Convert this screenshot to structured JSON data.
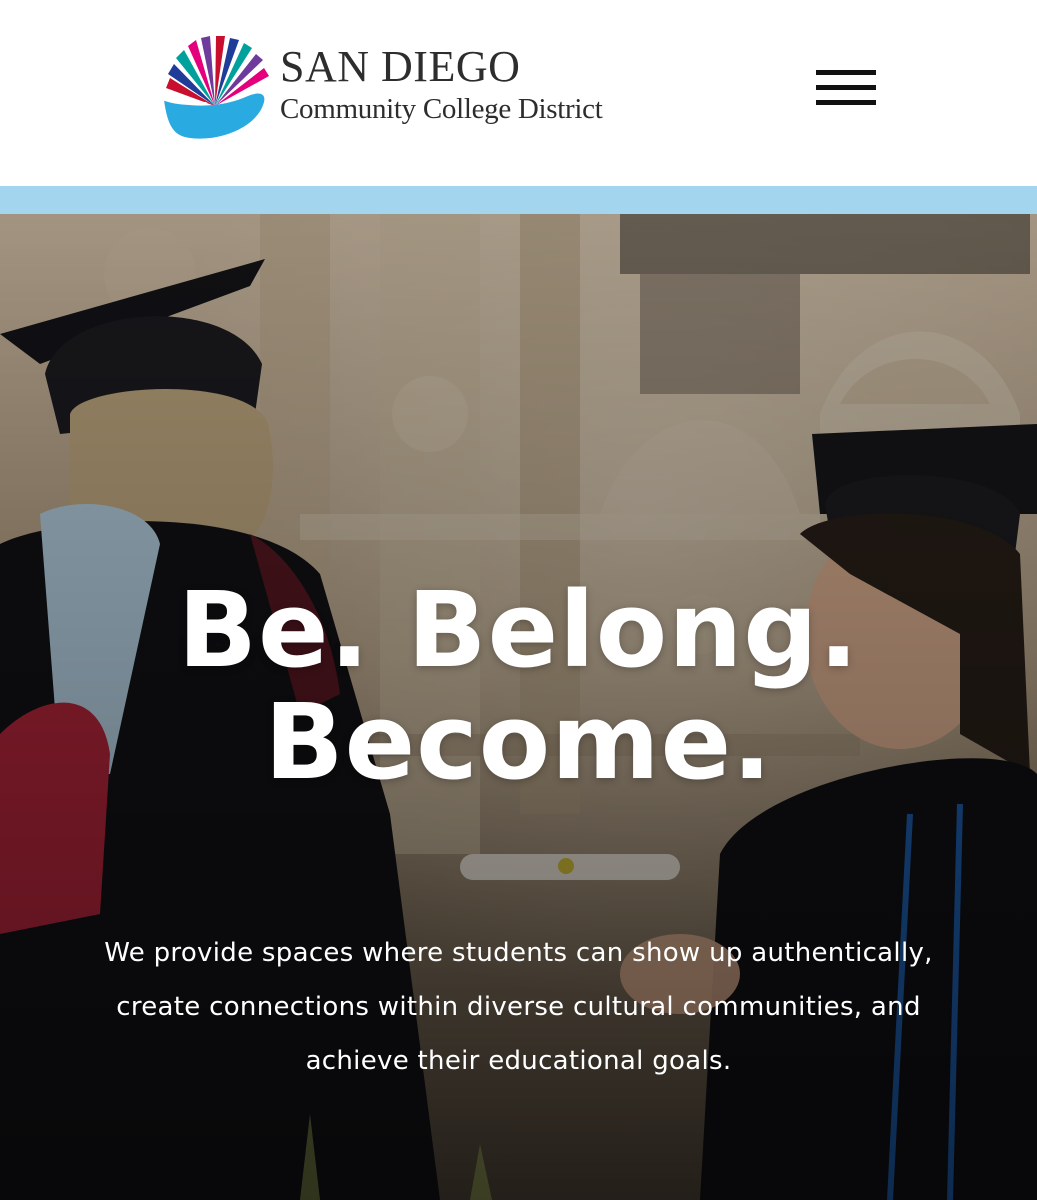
{
  "header": {
    "logo": {
      "title": "SAN DIEGO",
      "subtitle": "Community College District",
      "colors": [
        "#e4007c",
        "#c8102e",
        "#1f3c99",
        "#6e3b9c",
        "#00a19c",
        "#29abe2"
      ]
    },
    "menu_icon": "hamburger-menu-icon"
  },
  "colors": {
    "accent_strip": "#a3d6ee",
    "hero_text": "#ffffff"
  },
  "hero": {
    "title_line1": "Be. Belong.",
    "title_line2": "Become.",
    "description_line1": "We provide spaces where students can show up authentically,",
    "description_line2": "create connections within diverse cultural communities, and",
    "description_line3": "achieve their educational goals."
  }
}
